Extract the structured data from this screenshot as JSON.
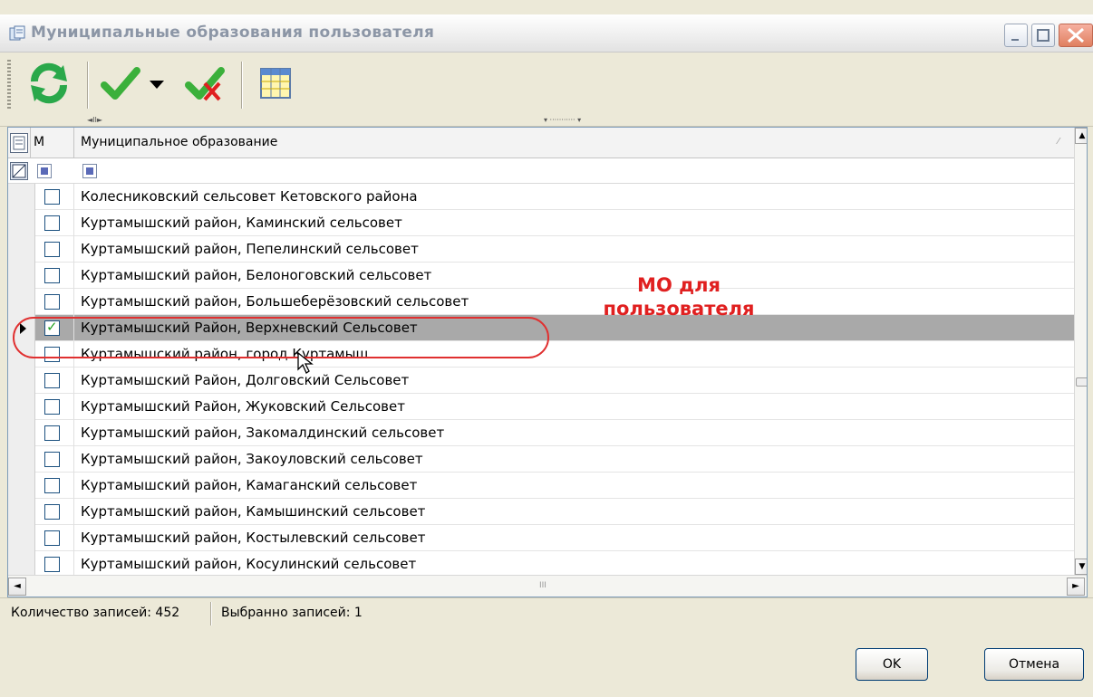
{
  "window": {
    "title": "Муниципальные образования пользователя",
    "colors": {
      "accent": "#21a121",
      "annotation": "#e02020",
      "selected_row": "#a9a9a9"
    }
  },
  "toolbar": {
    "tools": [
      "refresh-icon",
      "check-icon",
      "dropdown-icon",
      "uncheck-icon",
      "columns-icon"
    ]
  },
  "grid": {
    "headers": {
      "mark": "М",
      "name": "Муниципальное образование"
    },
    "rows": [
      {
        "name": "Колесниковский сельсовет Кетовского района",
        "checked": false
      },
      {
        "name": "Куртамышский район,  Каминский  сельсовет",
        "checked": false
      },
      {
        "name": "Куртамышский район,  Пепелинский сельсовет",
        "checked": false
      },
      {
        "name": "Куртамышский район, Белоноговский сельсовет",
        "checked": false
      },
      {
        "name": "Куртамышский район, Большеберёзовский сельсовет",
        "checked": false
      },
      {
        "name": "Куртамышский Район, Верхневский Сельсовет",
        "checked": true
      },
      {
        "name": "Куртамышский район, город Куртамыш",
        "checked": false
      },
      {
        "name": "Куртамышский Район, Долговский Сельсовет",
        "checked": false
      },
      {
        "name": "Куртамышский Район, Жуковский Сельсовет",
        "checked": false
      },
      {
        "name": "Куртамышский район, Закомалдинский сельсовет",
        "checked": false
      },
      {
        "name": "Куртамышский район, Закоуловский сельсовет",
        "checked": false
      },
      {
        "name": "Куртамышский район, Камаганский сельсовет",
        "checked": false
      },
      {
        "name": "Куртамышский район, Камышинский сельсовет",
        "checked": false
      },
      {
        "name": "Куртамышский район, Костылевский сельсовет",
        "checked": false
      },
      {
        "name": "Куртамышский район, Косулинский сельсовет",
        "checked": false
      }
    ]
  },
  "annotation": {
    "line1": "МО для",
    "line2": "пользователя"
  },
  "status": {
    "records": "Количество записей: 452",
    "selected": "Выбранно записей: 1"
  },
  "buttons": {
    "ok": "OK",
    "cancel": "Отмена"
  }
}
